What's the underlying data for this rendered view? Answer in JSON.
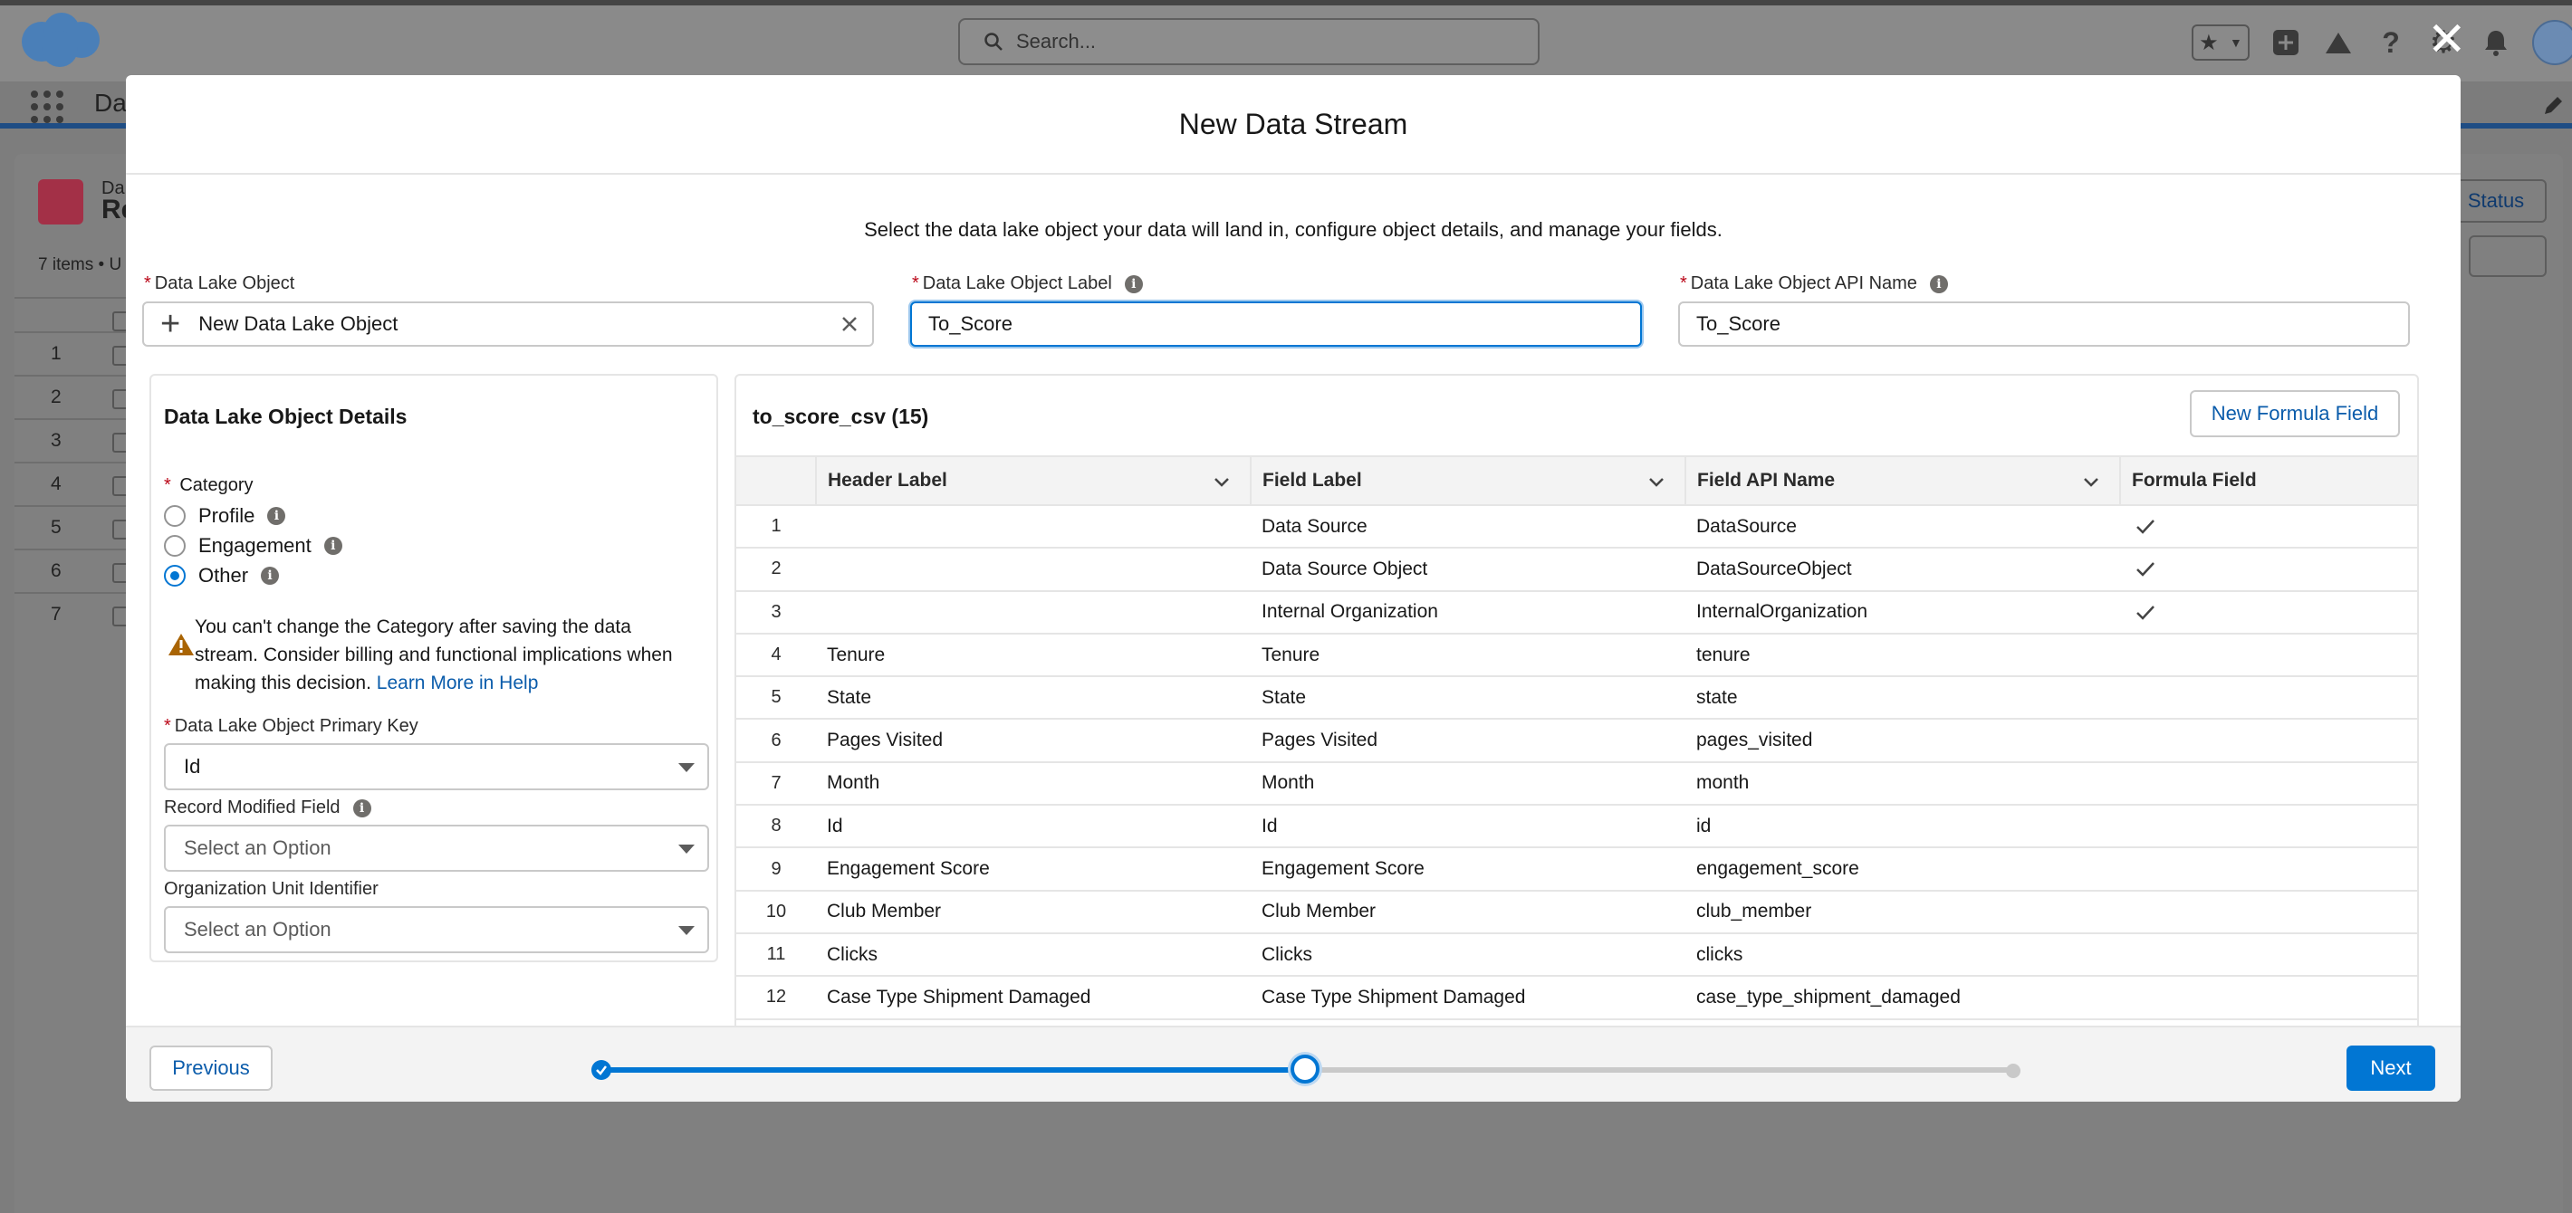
{
  "background": {
    "search_placeholder": "Search...",
    "app_name": "Da",
    "object_label_small": "Da",
    "object_label_big": "Re",
    "items_text": "7 items • U",
    "status_button": "Status",
    "row_numbers": [
      "1",
      "2",
      "3",
      "4",
      "5",
      "6",
      "7"
    ]
  },
  "modal": {
    "title": "New Data Stream",
    "subtitle": "Select the data lake object your data will land in, configure object details, and manage your fields.",
    "dlo": {
      "label": "Data Lake Object",
      "value": "New Data Lake Object"
    },
    "dlo_label": {
      "label": "Data Lake Object Label",
      "value": "To_Score"
    },
    "dlo_api": {
      "label": "Data Lake Object API Name",
      "value": "To_Score"
    },
    "details": {
      "title": "Data Lake Object Details",
      "category_label": "Category",
      "categories": [
        {
          "label": "Profile",
          "selected": false
        },
        {
          "label": "Engagement",
          "selected": false
        },
        {
          "label": "Other",
          "selected": true
        }
      ],
      "warning_text": "You can't change the Category after saving the data stream. Consider billing and functional implications when making this decision.",
      "warning_link": "Learn More in Help",
      "primary_key_label": "Data Lake Object Primary Key",
      "primary_key_value": "Id",
      "record_modified_label": "Record Modified Field",
      "record_modified_value": "Select an Option",
      "org_unit_label": "Organization Unit Identifier",
      "org_unit_value": "Select an Option"
    },
    "fields": {
      "title": "to_score_csv (15)",
      "new_formula_button": "New Formula Field",
      "columns": [
        "Header Label",
        "Field Label",
        "Field API Name",
        "Formula Field"
      ],
      "rows": [
        {
          "num": "1",
          "header": "",
          "label": "Data Source",
          "api": "DataSource",
          "formula": true
        },
        {
          "num": "2",
          "header": "",
          "label": "Data Source Object",
          "api": "DataSourceObject",
          "formula": true
        },
        {
          "num": "3",
          "header": "",
          "label": "Internal Organization",
          "api": "InternalOrganization",
          "formula": true
        },
        {
          "num": "4",
          "header": "Tenure",
          "label": "Tenure",
          "api": "tenure",
          "formula": false
        },
        {
          "num": "5",
          "header": "State",
          "label": "State",
          "api": "state",
          "formula": false
        },
        {
          "num": "6",
          "header": "Pages Visited",
          "label": "Pages Visited",
          "api": "pages_visited",
          "formula": false
        },
        {
          "num": "7",
          "header": "Month",
          "label": "Month",
          "api": "month",
          "formula": false
        },
        {
          "num": "8",
          "header": "Id",
          "label": "Id",
          "api": "id",
          "formula": false
        },
        {
          "num": "9",
          "header": "Engagement Score",
          "label": "Engagement Score",
          "api": "engagement_score",
          "formula": false
        },
        {
          "num": "10",
          "header": "Club Member",
          "label": "Club Member",
          "api": "club_member",
          "formula": false
        },
        {
          "num": "11",
          "header": "Clicks",
          "label": "Clicks",
          "api": "clicks",
          "formula": false
        },
        {
          "num": "12",
          "header": "Case Type Shipment Damaged",
          "label": "Case Type Shipment Damaged",
          "api": "case_type_shipment_damaged",
          "formula": false
        }
      ]
    },
    "footer": {
      "previous": "Previous",
      "next": "Next",
      "progress_fraction": 0.5,
      "steps": [
        "complete",
        "current",
        "incomplete"
      ]
    }
  },
  "colors": {
    "brand_blue": "#0176d3",
    "link_blue": "#0b5cab",
    "required_red": "#ba0517"
  }
}
